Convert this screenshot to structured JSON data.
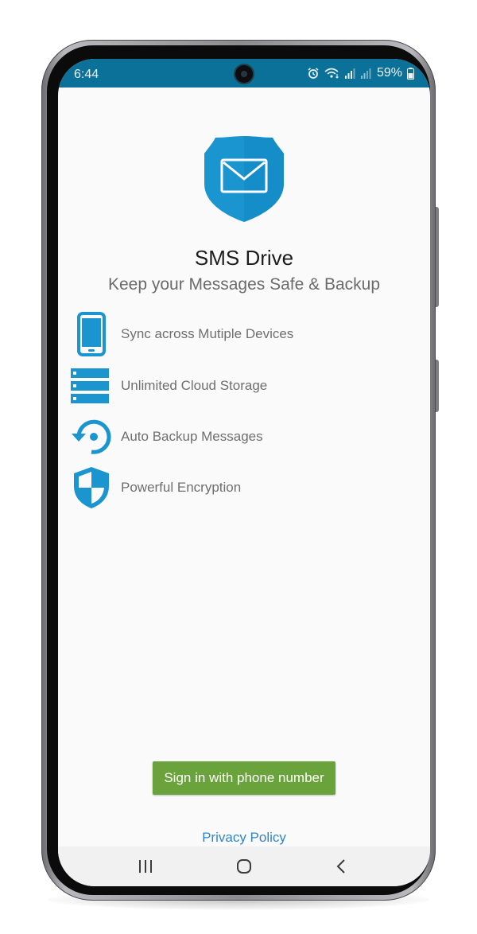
{
  "status_bar": {
    "time": "6:44",
    "battery": "59%",
    "icons": [
      "alarm-icon",
      "wifi-icon",
      "signal-icon",
      "signal-icon",
      "battery-icon"
    ],
    "background_color": "#0b7199"
  },
  "app": {
    "title": "SMS Drive",
    "subtitle": "Keep your Messages Safe & Backup",
    "logo_icon": "shield-envelope-icon",
    "accent_color": "#1b95d0"
  },
  "features": [
    {
      "icon": "phone-icon",
      "label": "Sync across Mutiple Devices"
    },
    {
      "icon": "server-icon",
      "label": "Unlimited Cloud Storage"
    },
    {
      "icon": "backup-restore-icon",
      "label": "Auto Backup Messages"
    },
    {
      "icon": "shield-icon",
      "label": "Powerful Encryption"
    }
  ],
  "actions": {
    "signin_label": "Sign in with phone number",
    "signin_color": "#6aa33b",
    "privacy_label": "Privacy Policy",
    "privacy_color": "#2f86c6"
  },
  "nav": {
    "recent_icon": "recent-apps-icon",
    "home_icon": "home-icon",
    "back_icon": "back-icon"
  }
}
